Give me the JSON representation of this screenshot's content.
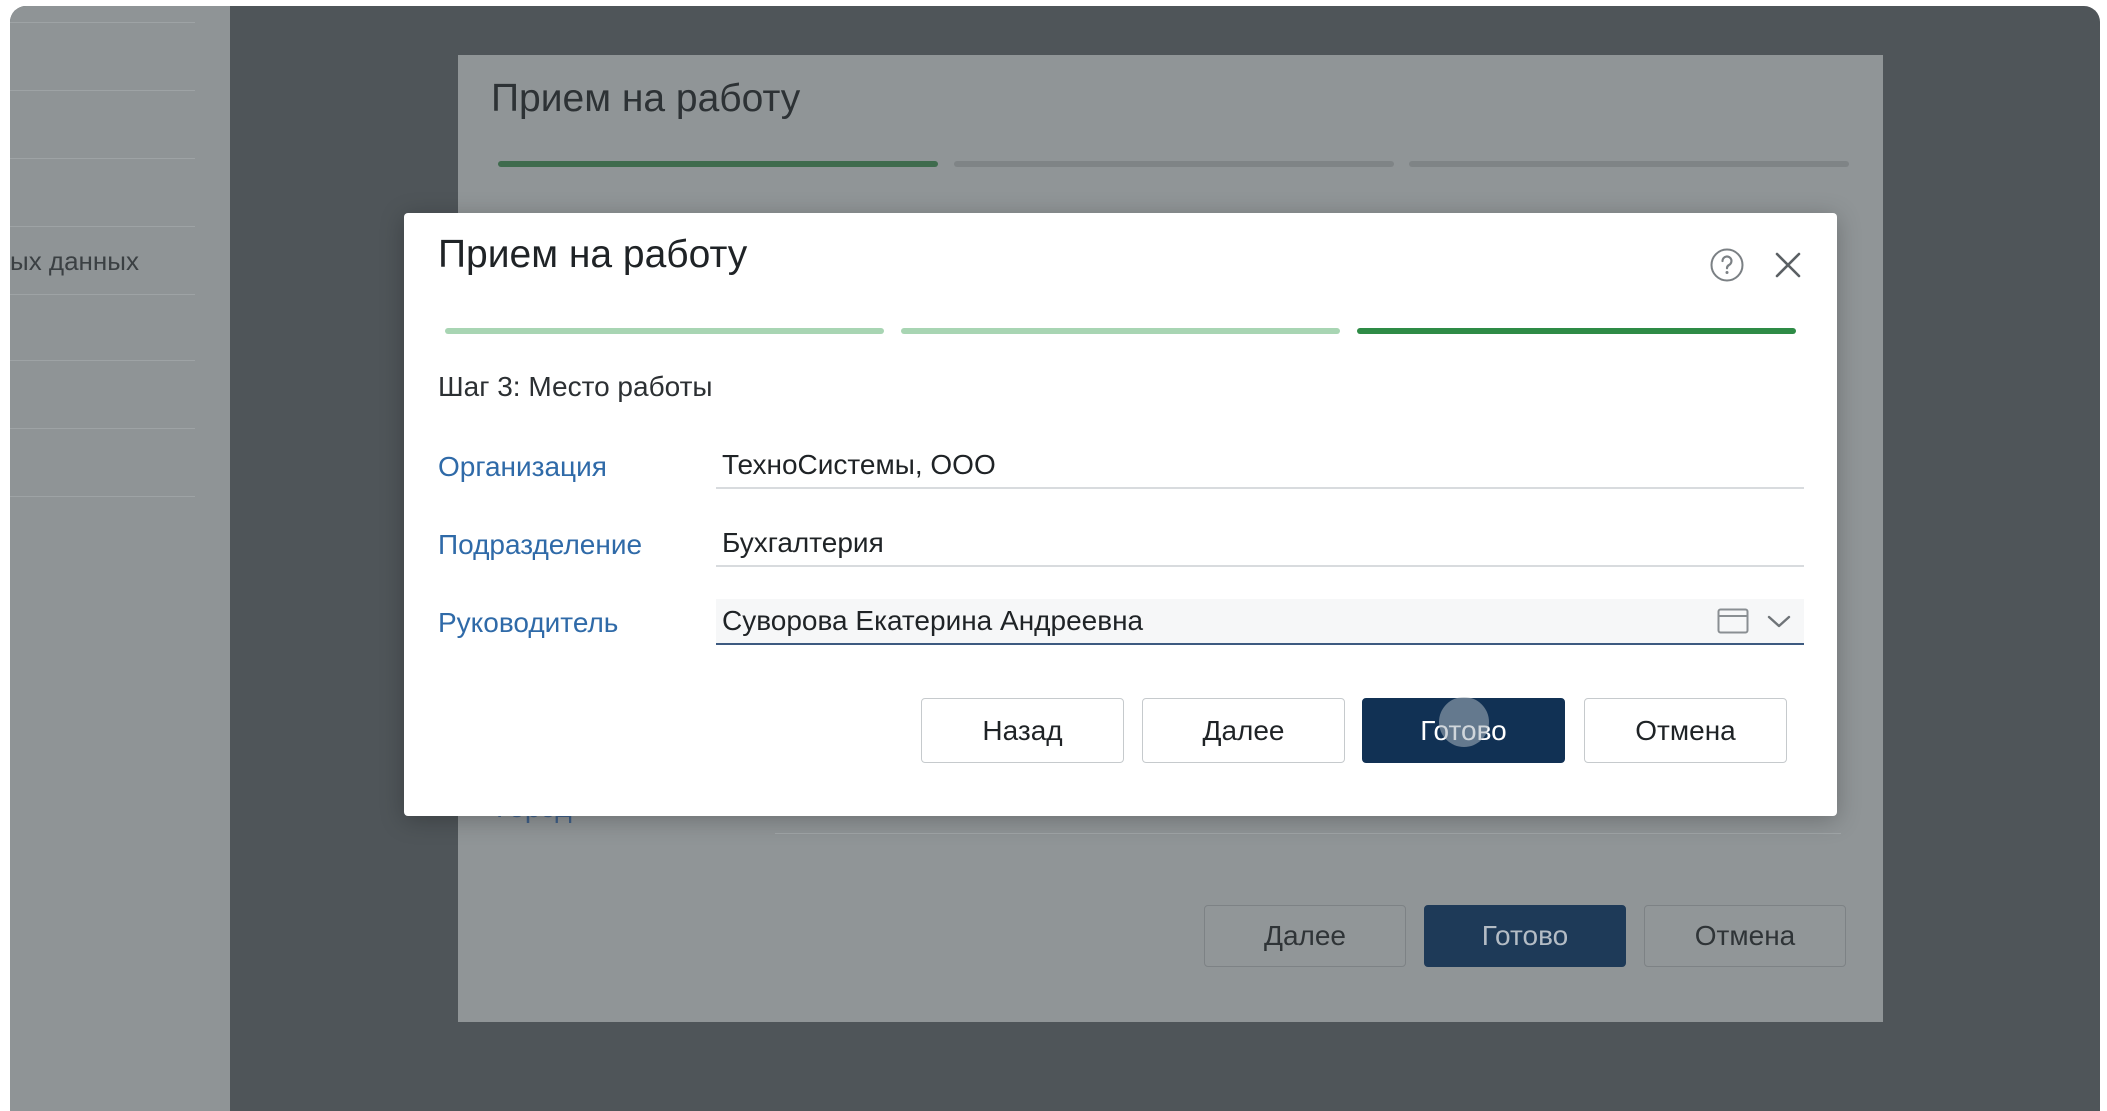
{
  "sidebar": {
    "partial_item_text": "ых данных"
  },
  "background_dialog": {
    "title": "Прием на работу",
    "partial_field_label": "Город",
    "buttons": {
      "next": "Далее",
      "done": "Готово",
      "cancel": "Отмена"
    }
  },
  "dialog": {
    "title": "Прием на работу",
    "help_icon": "question-circle-icon",
    "close_icon": "close-icon",
    "progress": {
      "total_steps": 3,
      "current_step": 3
    },
    "step_label": "Шаг 3: Место работы",
    "fields": {
      "organization": {
        "label": "Организация",
        "value": "ТехноСистемы, ООО"
      },
      "department": {
        "label": "Подразделение",
        "value": "Бухгалтерия"
      },
      "manager": {
        "label": "Руководитель",
        "value": "Суворова Екатерина Андреевна"
      }
    },
    "buttons": {
      "back": "Назад",
      "next": "Далее",
      "done": "Готово",
      "cancel": "Отмена"
    }
  },
  "colors": {
    "accent_green": "#2e8b46",
    "progress_done": "#a8d5b3",
    "primary_button": "#113154",
    "label_blue": "#2f6aa8"
  }
}
